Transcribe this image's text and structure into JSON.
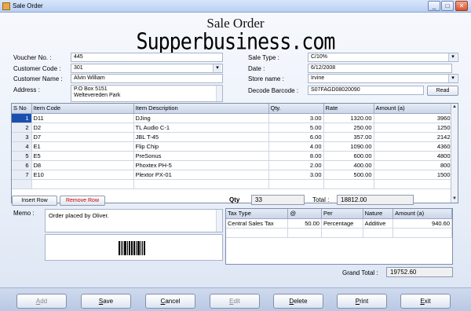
{
  "window": {
    "title": "Sale Order",
    "minimize": "_",
    "maximize": "□",
    "close": "✕"
  },
  "heading": "Sale Order",
  "brand": "Supperbusiness.com",
  "form": {
    "voucher_no_label": "Voucher No. :",
    "voucher_no": "445",
    "customer_code_label": "Customer Code :",
    "customer_code": "301",
    "customer_name_label": "Customer Name :",
    "customer_name": "Alvin William",
    "address_label": "Address :",
    "address_line1": "P.O Box 5151",
    "address_line2": "Weltevereden Park",
    "sale_type_label": "Sale Type :",
    "sale_type": "C/10%",
    "date_label": "Date :",
    "date": "6/12/2008",
    "store_label": "Store name :",
    "store": "Irvine",
    "decode_label": "Decode Barcode :",
    "decode_value": "S07FAGD08020090",
    "read_button": "Read"
  },
  "items": {
    "columns": [
      "S No",
      "Item Code",
      "Item Description",
      "Qty.",
      "Rate",
      "Amount (a)"
    ],
    "rows": [
      {
        "sno": "1",
        "code": "D11",
        "desc": "DJing",
        "qty": "3.00",
        "rate": "1320.00",
        "amount": "3960"
      },
      {
        "sno": "2",
        "code": "D2",
        "desc": "TL Audio C-1",
        "qty": "5.00",
        "rate": "250.00",
        "amount": "1250"
      },
      {
        "sno": "3",
        "code": "D7",
        "desc": "JBL T-45",
        "qty": "6.00",
        "rate": "357.00",
        "amount": "2142"
      },
      {
        "sno": "4",
        "code": "E1",
        "desc": "Flip Chip",
        "qty": "4.00",
        "rate": "1090.00",
        "amount": "4360"
      },
      {
        "sno": "5",
        "code": "E5",
        "desc": "PreSonus",
        "qty": "8.00",
        "rate": "600.00",
        "amount": "4800"
      },
      {
        "sno": "6",
        "code": "D8",
        "desc": "Phoxtex PH-5",
        "qty": "2.00",
        "rate": "400.00",
        "amount": "800"
      },
      {
        "sno": "7",
        "code": "E10",
        "desc": "Plextor PX-01",
        "qty": "3.00",
        "rate": "500.00",
        "amount": "1500"
      }
    ]
  },
  "actions": {
    "insert_row": "Insert Row",
    "remove_row": "Remove Row"
  },
  "summary": {
    "qty_label": "Qty",
    "qty": "33",
    "total_label": "Total :",
    "total": "18812.00",
    "grand_total_label": "Grand Total :",
    "grand_total": "19752.60"
  },
  "memo": {
    "label": "Memo :",
    "text": "Order placed by Oliver."
  },
  "tax": {
    "columns": [
      "Tax Type",
      "@",
      "Per",
      "Nature",
      "Amount (a)"
    ],
    "rows": [
      {
        "type": "Central Sales Tax",
        "at": "50.00",
        "per": "Percentage",
        "nature": "Additive",
        "amount": "940.60"
      }
    ]
  },
  "footer": {
    "add": {
      "first": "A",
      "rest": "dd"
    },
    "save": {
      "first": "S",
      "rest": "ave"
    },
    "cancel": {
      "first": "C",
      "rest": "ancel"
    },
    "edit": {
      "first": "E",
      "rest": "dit"
    },
    "delete": {
      "first": "D",
      "rest": "elete"
    },
    "print": {
      "first": "P",
      "rest": "rint"
    },
    "exit": {
      "first": "E",
      "rest": "xit"
    }
  }
}
